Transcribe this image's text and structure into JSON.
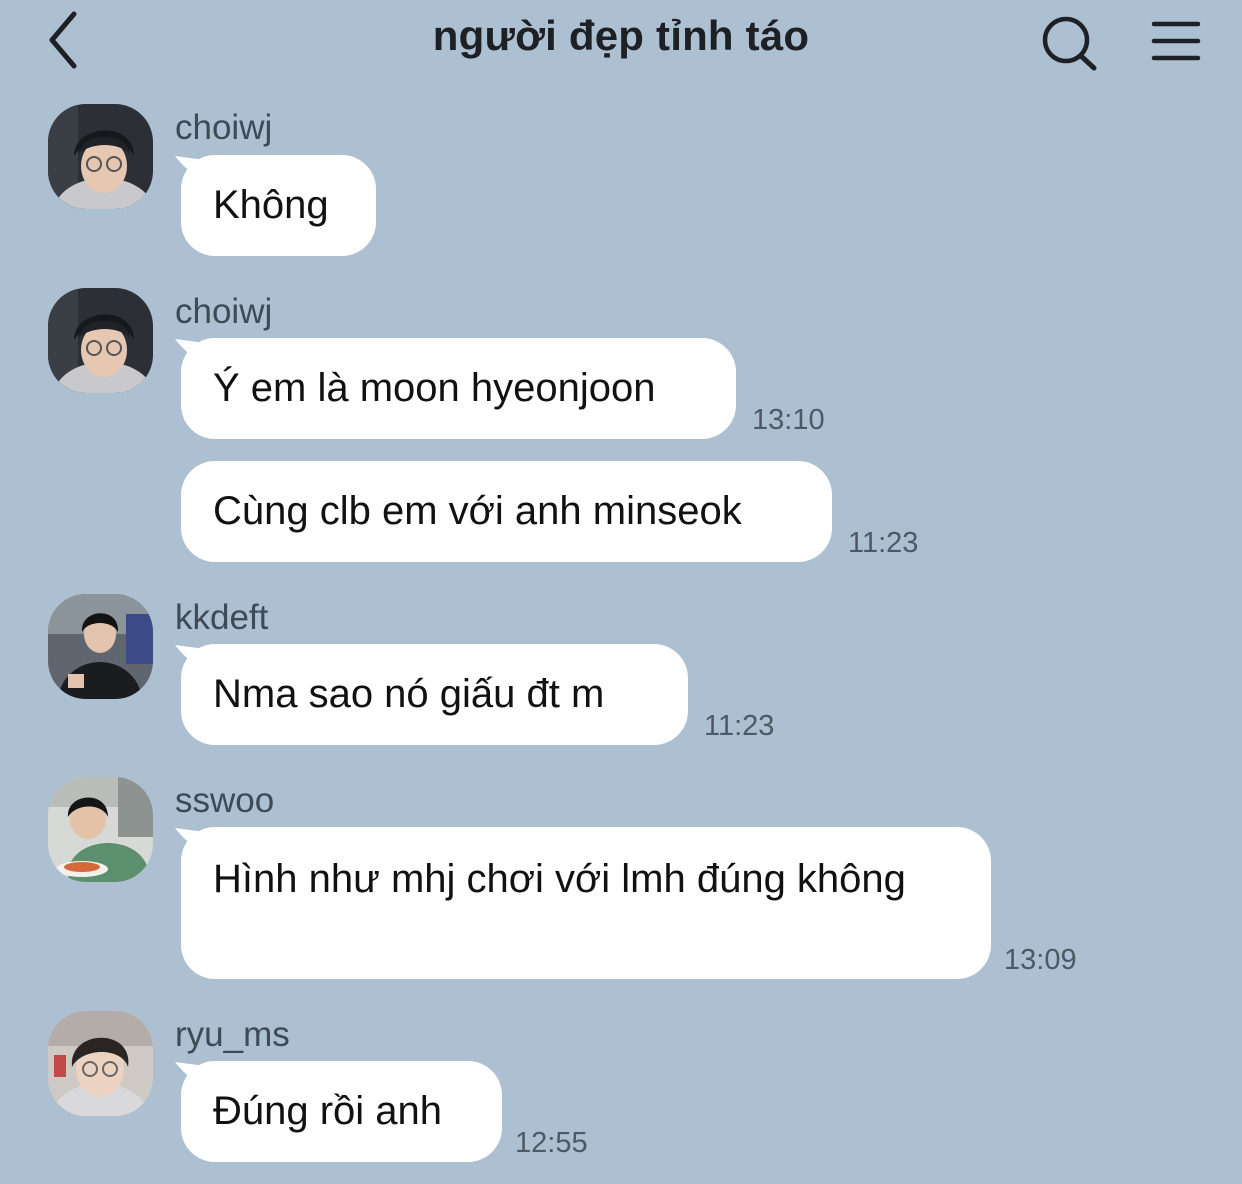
{
  "header": {
    "title": "người đẹp tỉnh táo"
  },
  "icons": {
    "back": "chevron-left-icon",
    "search": "search-icon",
    "menu": "hamburger-menu-icon"
  },
  "colors": {
    "background": "#acc0d1",
    "bubble": "#ffffff",
    "meta_text": "#4d5965"
  },
  "messages": [
    {
      "sender": "choiwj",
      "text": "Không",
      "time": ""
    },
    {
      "sender": "choiwj",
      "text": "Ý em là moon hyeonjoon",
      "time": "13:10"
    },
    {
      "sender": "",
      "text": "Cùng clb em với anh minseok",
      "time": "11:23"
    },
    {
      "sender": "kkdeft",
      "text": "Nma sao nó giấu đt m",
      "time": "11:23"
    },
    {
      "sender": "sswoo",
      "text": "Hình như mhj chơi với lmh đúng không",
      "time": "13:09"
    },
    {
      "sender": "ryu_ms",
      "text": "Đúng rồi anh",
      "time": "12:55"
    }
  ]
}
